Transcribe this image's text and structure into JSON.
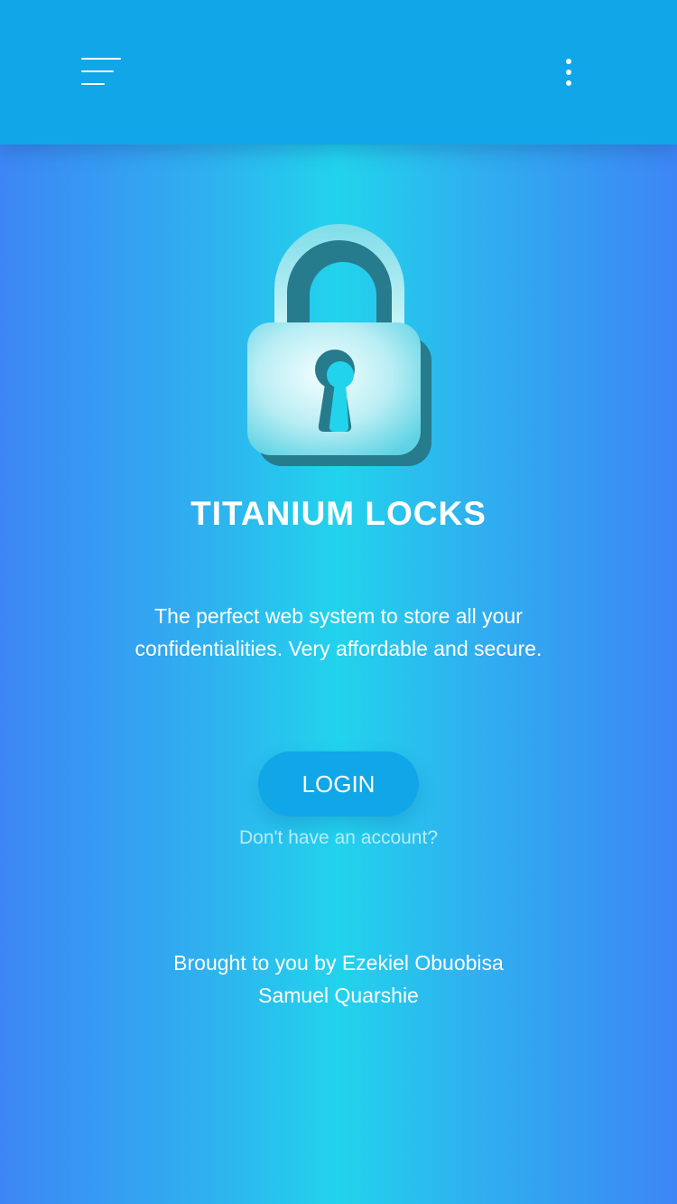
{
  "header": {
    "menu_icon": "hamburger-menu-icon",
    "more_icon": "more-vertical-icon",
    "background_color": "#10a6e8"
  },
  "hero": {
    "illustration_icon": "padlock-icon",
    "title": "TITANIUM LOCKS",
    "tagline": "The perfect web system to store all your confidentialities. Very affordable and secure."
  },
  "actions": {
    "login_label": "LOGIN",
    "signup_prompt": "Don't have an account?"
  },
  "credits": {
    "line1": "Brought to you by Ezekiel Obuobisa",
    "line2": "Samuel Quarshie"
  },
  "colors": {
    "accent": "#10a6e8",
    "gradient_center": "#22d3ec",
    "gradient_edge": "#3d86f5",
    "link": "#b6ecf8"
  }
}
